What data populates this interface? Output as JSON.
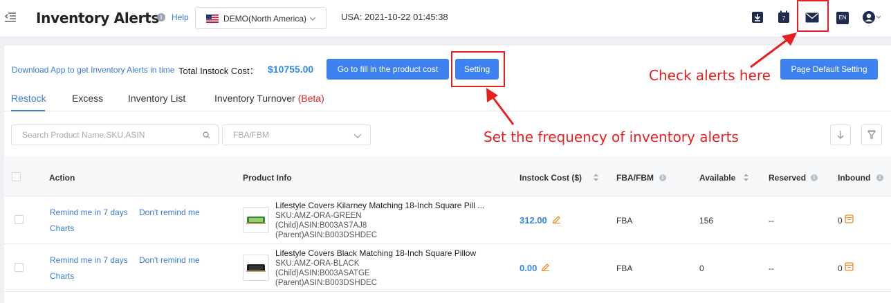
{
  "header": {
    "title": "Inventory Alerts",
    "help": "Help",
    "region": "DEMO(North America)",
    "datetime": "USA: 2021-10-22 01:45:38",
    "lang": "EN",
    "calendar_day": "7"
  },
  "toolbar": {
    "download_link": "Download App to get Inventory Alerts in time",
    "total_label": "Total Instock Cost：",
    "total_value": "$10755.00",
    "fill_cost_button": "Go to fill in the product cost",
    "setting_button": "Setting",
    "page_default_button": "Page Default Setting"
  },
  "tabs": [
    {
      "label": "Restock"
    },
    {
      "label": "Excess"
    },
    {
      "label": "Inventory List"
    },
    {
      "label": "Inventory Turnover",
      "suffix": "(Beta)"
    }
  ],
  "filters": {
    "search_placeholder": "Search Product Name,SKU,ASIN",
    "fba_placeholder": "FBA/FBM"
  },
  "table": {
    "columns": [
      "Action",
      "Product Info",
      "Instock Cost ($)",
      "FBA/FBM",
      "Available",
      "Reserved",
      "Inbound"
    ],
    "rows": [
      {
        "remind": "Remind me in 7 days",
        "dont_remind": "Don't remind me",
        "charts": "Charts",
        "name": "Lifestyle Covers Kilarney Matching 18-Inch Square Pill ...",
        "sku": "SKU:AMZ-ORA-GREEN",
        "child_asin": "(Child)ASIN:B003AS7AJ8",
        "parent_asin": "(Parent)ASIN:B003DSHDEC",
        "cost": "312.00",
        "fba": "FBA",
        "available": "156",
        "reserved": "--",
        "inbound": "0"
      },
      {
        "remind": "Remind me in 7 days",
        "dont_remind": "Don't remind me",
        "charts": "Charts",
        "name": "Lifestyle Covers Black Matching 18-Inch Square Pillow",
        "sku": "SKU:AMZ-ORA-BLACK",
        "child_asin": "(Child)ASIN:B003ASATGE",
        "parent_asin": "(Parent)ASIN:B003DSHDEC",
        "cost": "0.00",
        "fba": "FBA",
        "available": "0",
        "reserved": "--",
        "inbound": "0"
      }
    ]
  },
  "annotations": {
    "check_alerts": "Check alerts here",
    "set_frequency": "Set the frequency of inventory alerts"
  },
  "colors": {
    "primary": "#3d82f0",
    "link": "#3a7bd5",
    "annotation": "#e62020",
    "cost": "#2f8ae5",
    "edit": "#f08a24"
  }
}
